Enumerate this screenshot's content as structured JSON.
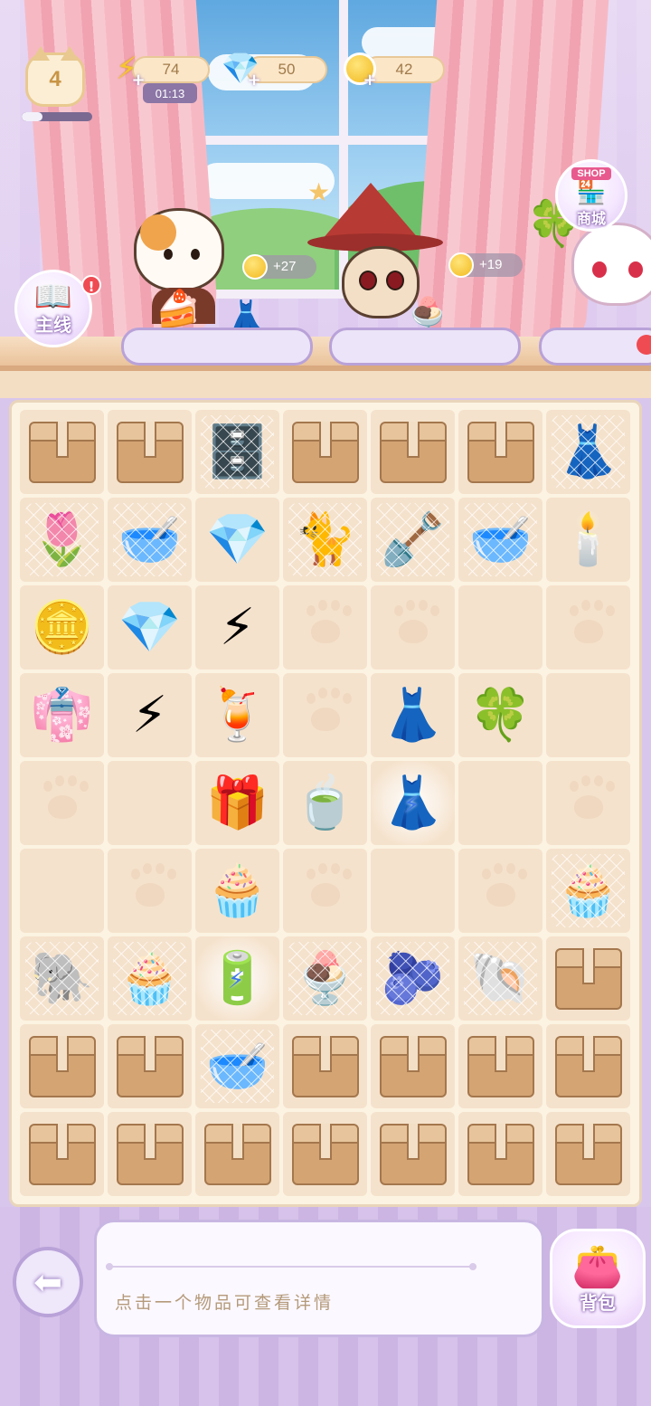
{
  "hud": {
    "level": "4",
    "level_progress": 0.3,
    "energy": "74",
    "energy_timer": "01:13",
    "gems": "50",
    "coins": "42"
  },
  "side_buttons": {
    "main_quest_label": "主线",
    "main_quest_alert": "!",
    "shop_sign": "SHOP",
    "shop_label": "商城"
  },
  "customers": [
    {
      "reward": "+27"
    },
    {
      "reward": "+19"
    }
  ],
  "board": {
    "rows": [
      [
        "box",
        "box",
        "cabinet",
        "box",
        "box",
        "box",
        "rack"
      ],
      [
        "tulip",
        "bowl-brown",
        "pink-gem",
        "cat",
        "shovel",
        "bowl-teal",
        "candelabra"
      ],
      [
        "coins-pile",
        "pink-gems",
        "energy-double",
        "paw",
        "paw",
        "empty",
        "paw"
      ],
      [
        "dress-gold",
        "energy",
        "lemonade",
        "paw",
        "white-dress",
        "clover",
        "empty"
      ],
      [
        "paw",
        "empty",
        "pink-case",
        "tea-cup",
        "rack-energy",
        "empty",
        "paw"
      ],
      [
        "empty",
        "paw",
        "cream-puff",
        "paw",
        "empty",
        "paw",
        "cupcake"
      ],
      [
        "elephant",
        "cupcake",
        "vending-energy",
        "dessert-cup",
        "bowl-purple",
        "shell",
        "box"
      ],
      [
        "box",
        "box",
        "bowl-lilac",
        "box",
        "box",
        "box",
        "box"
      ],
      [
        "box",
        "box",
        "box",
        "box",
        "box",
        "box",
        "box"
      ]
    ],
    "webbed": [
      "0-2",
      "0-6",
      "1-0",
      "1-1",
      "1-3",
      "1-4",
      "1-5",
      "5-6",
      "6-0",
      "6-1",
      "6-3",
      "6-4",
      "6-5",
      "7-2"
    ],
    "glowing": [
      "4-4",
      "6-2"
    ]
  },
  "icons": {
    "cabinet": "🗄️",
    "rack": "👗",
    "tulip": "🌷",
    "bowl-brown": "🥣",
    "pink-gem": "💎",
    "cat": "🐈",
    "shovel": "🪏",
    "bowl-teal": "🥣",
    "candelabra": "🕯️",
    "coins-pile": "🪙",
    "pink-gems": "💎",
    "energy-double": "⚡",
    "dress-gold": "👘",
    "energy": "⚡",
    "lemonade": "🍹",
    "white-dress": "👗",
    "clover": "🍀",
    "pink-case": "🎁",
    "tea-cup": "🍵",
    "rack-energy": "👗",
    "cream-puff": "🧁",
    "cupcake": "🧁",
    "elephant": "🐘",
    "vending-energy": "🔋",
    "dessert-cup": "🍨",
    "bowl-purple": "🫐",
    "shell": "🐚",
    "bowl-lilac": "🥣"
  },
  "bottom": {
    "info_text": "点击一个物品可查看详情",
    "bag_label": "背包"
  },
  "colors": {
    "board_bg": "#fcf3e2",
    "cell_bg": "#f5e2cc",
    "accent_purple": "#b9a2d8"
  }
}
